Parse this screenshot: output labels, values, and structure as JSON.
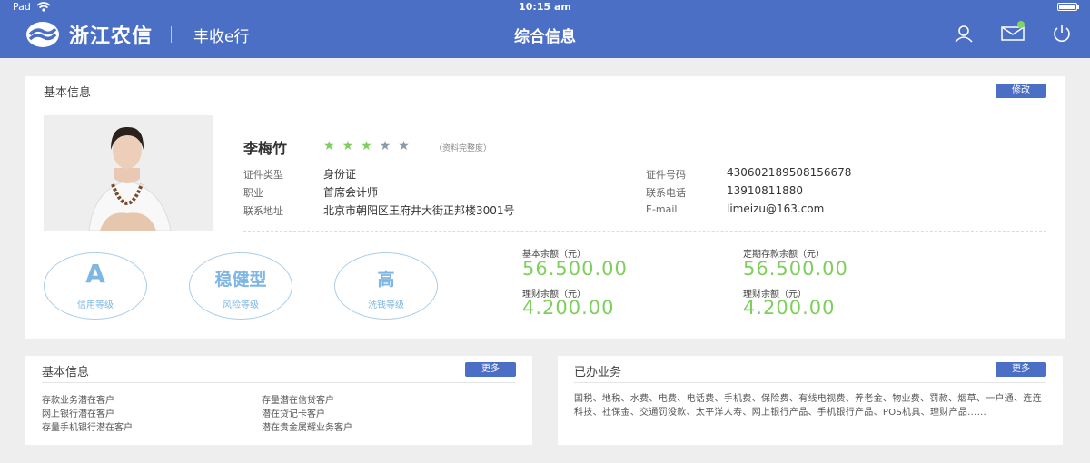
{
  "status": {
    "device": "Pad",
    "time": "10:15 am",
    "battery_level": 0.95
  },
  "header": {
    "brand": "浙江农信",
    "slogan": "丰收e行",
    "title": "综合信息"
  },
  "icons": {
    "wifi": "wifi-icon",
    "user": "user-icon",
    "mail": "mail-icon",
    "power": "power-icon"
  },
  "profile": {
    "section_title": "基本信息",
    "edit_label": "修改",
    "name": "李梅竹",
    "rating": 3,
    "rating_max": 5,
    "completeness_label": "（资料完整度）",
    "fields": {
      "id_type_label": "证件类型",
      "id_type": "身份证",
      "occupation_label": "职业",
      "occupation": "首席会计师",
      "address_label": "联系地址",
      "address": "北京市朝阳区王府井大街正邦楼3001号",
      "id_no_label": "证件号码",
      "id_no": "430602189508156678",
      "phone_label": "联系电话",
      "phone": "13910811880",
      "email_label": "E-mail",
      "email": "limeizu@163.com"
    },
    "ratings": [
      {
        "value": "A",
        "label": "信用等级"
      },
      {
        "value": "稳健型",
        "label": "风险等级"
      },
      {
        "value": "高",
        "label": "洗钱等级"
      }
    ],
    "balances": [
      {
        "label": "基本余额（元）",
        "value": "56.500.00"
      },
      {
        "label": "定期存款余额（元）",
        "value": "56.500.00"
      },
      {
        "label": "理财余额（元）",
        "value": "4.200.00"
      },
      {
        "label": "理财余额（元）",
        "value": "4.200.00"
      }
    ]
  },
  "basic": {
    "title": "基本信息",
    "more_label": "更多",
    "items": [
      "存款业务潜在客户",
      "存量潜在信贷客户",
      "网上银行潜在客户",
      "潜在贷记卡客户",
      "存量手机银行潜在客户",
      "潜在贵金属耀业务客户"
    ]
  },
  "business": {
    "title": "已办业务",
    "more_label": "更多",
    "text": "国税、地税、水费、电费、电话费、手机费、保险费、有线电视费、养老金、物业费、罚款、烟草、一户通、连连科技、社保金、交通罚没款、太平洋人寿、网上银行产品、手机银行产品、POS机具、理财产品......"
  }
}
